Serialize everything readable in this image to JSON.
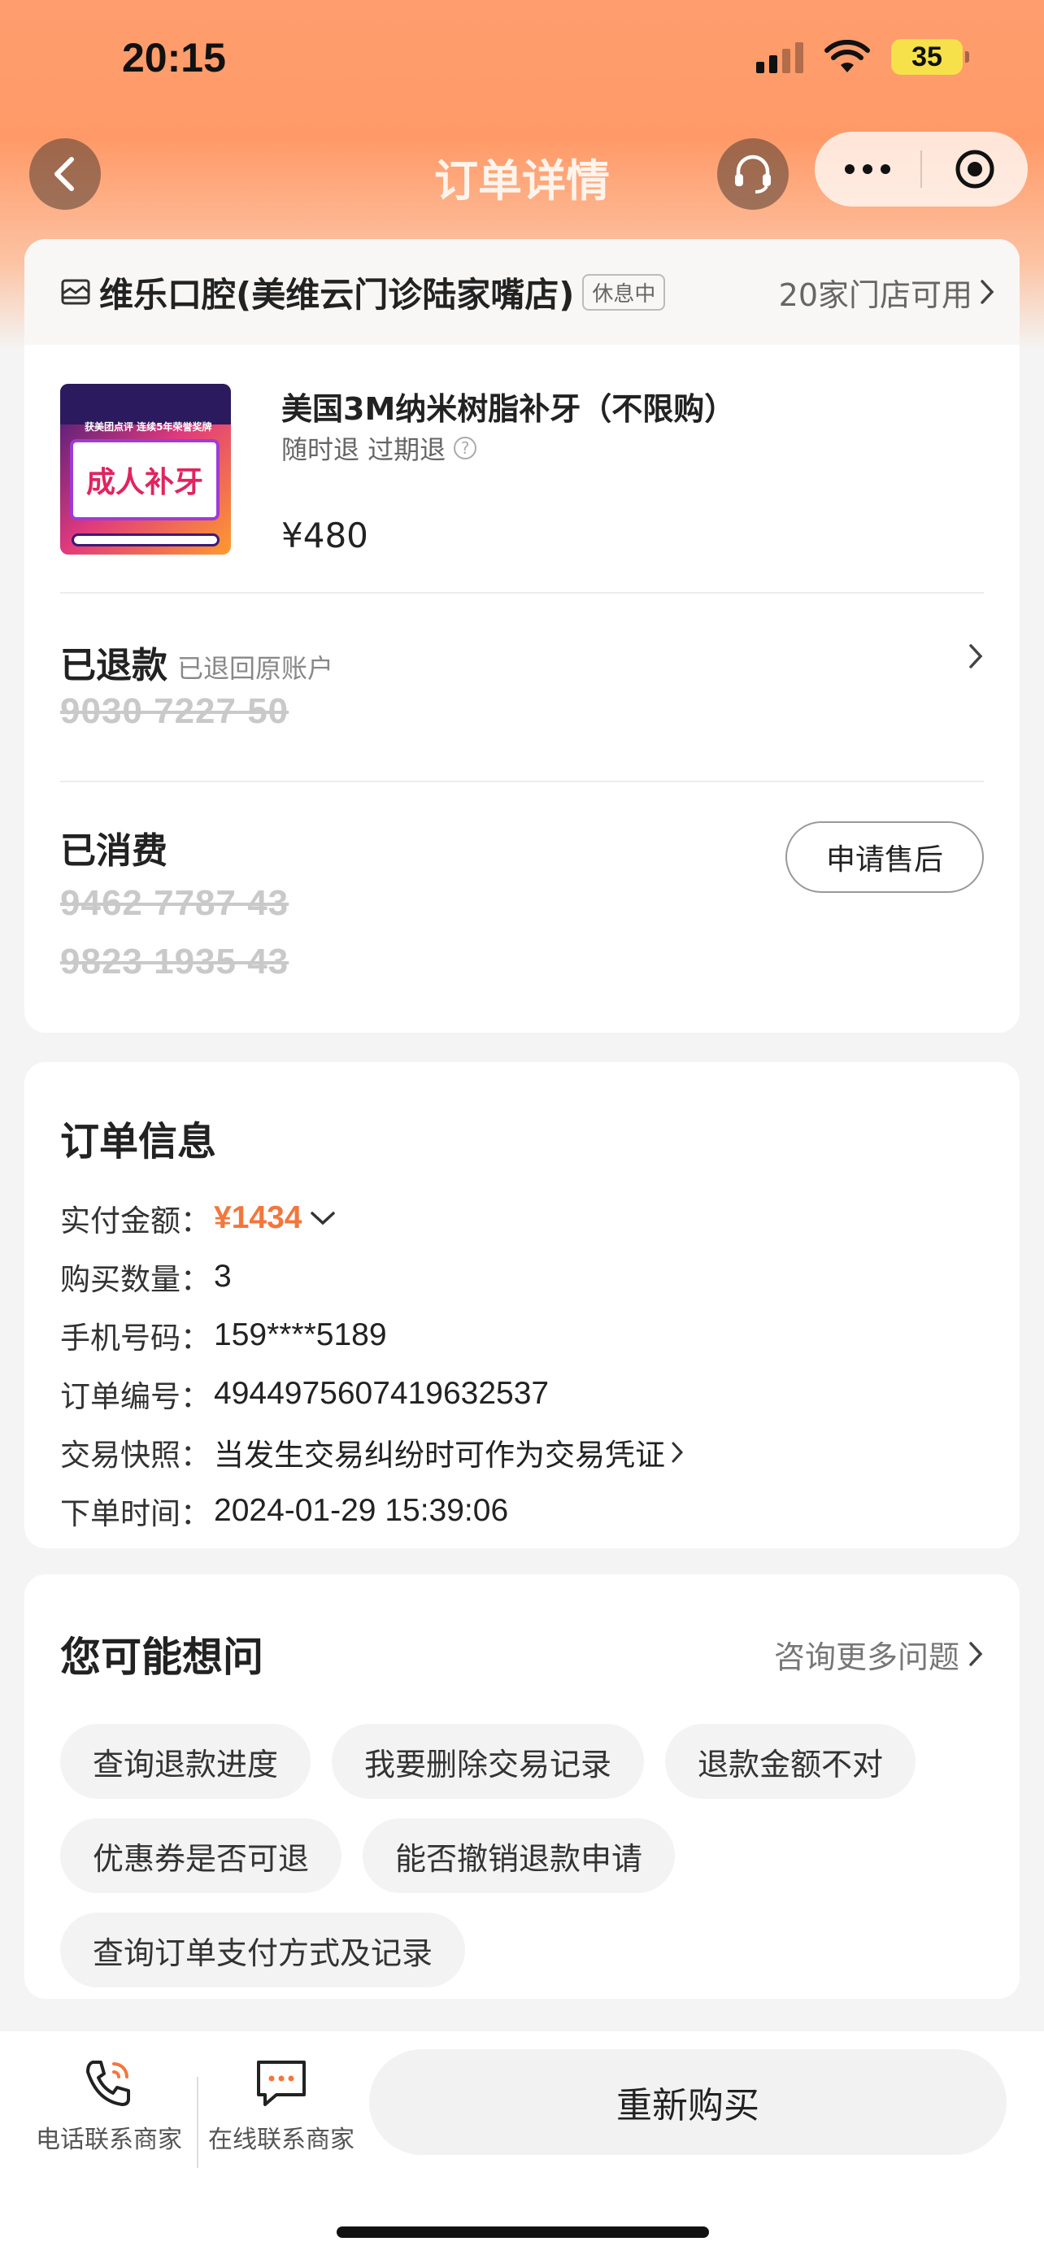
{
  "status": {
    "time": "20:15",
    "battery": "35"
  },
  "nav": {
    "title": "订单详情"
  },
  "store": {
    "name": "维乐口腔(美维云门诊陆家嘴店)",
    "tag": "休息中",
    "available": "20家门店可用"
  },
  "product": {
    "title": "美国3M纳米树脂补牙（不限购）",
    "sub": "随时退 过期退",
    "price": "¥480",
    "thumb_top": "获美团点评 连续5年荣誉奖牌",
    "thumb_text": "成人补牙"
  },
  "refund": {
    "title": "已退款",
    "note": "已退回原账户",
    "codes": [
      "9030 7227 50"
    ]
  },
  "consumed": {
    "title": "已消费",
    "codes": [
      "9462 7787 43",
      "9823 1935 43"
    ],
    "button": "申请售后"
  },
  "order_info": {
    "title": "订单信息",
    "paid_label": "实付金额：",
    "paid_value": "¥1434",
    "qty_label": "购买数量：",
    "qty_value": "3",
    "phone_label": "手机号码：",
    "phone_value": "159****5189",
    "order_no_label": "订单编号：",
    "order_no_value": "4944975607419632537",
    "snapshot_label": "交易快照：",
    "snapshot_value": "当发生交易纠纷时可作为交易凭证",
    "time_label": "下单时间：",
    "time_value": "2024-01-29 15:39:06"
  },
  "faq": {
    "title": "您可能想问",
    "more": "咨询更多问题",
    "chips": [
      "查询退款进度",
      "我要删除交易记录",
      "退款金额不对",
      "优惠券是否可退",
      "能否撤销退款申请",
      "查询订单支付方式及记录"
    ]
  },
  "bottom": {
    "phone": "电话联系商家",
    "online": "在线联系商家",
    "rebuy": "重新购买"
  },
  "colors": {
    "accent": "#f2773d",
    "header": "#ff9d6e"
  }
}
